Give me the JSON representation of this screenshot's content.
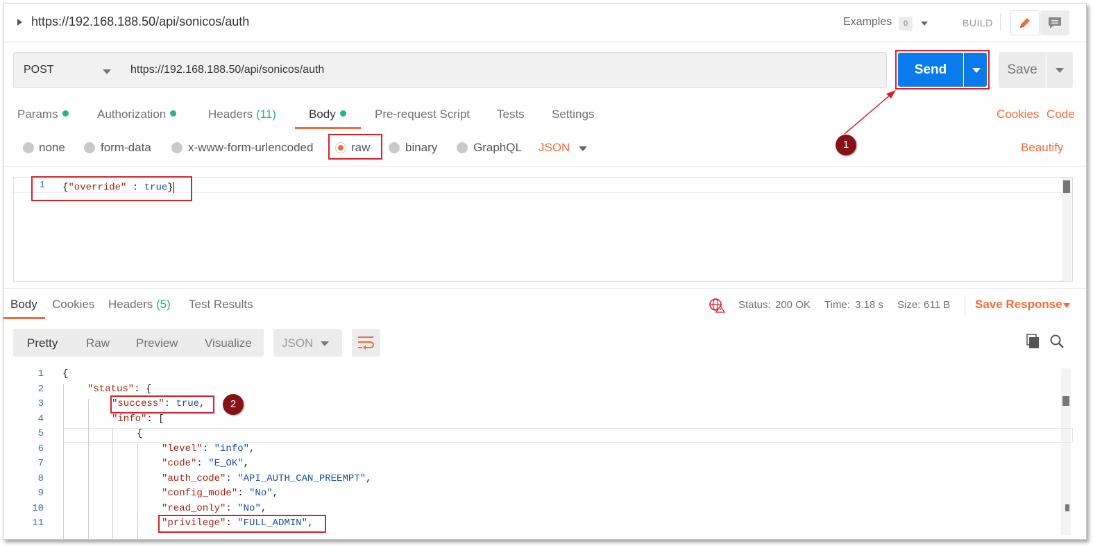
{
  "topbar": {
    "title": "https://192.168.188.50/api/sonicos/auth",
    "examples_label": "Examples",
    "examples_count": "0",
    "build_label": "BUILD"
  },
  "request": {
    "method": "POST",
    "url": "https://192.168.188.50/api/sonicos/auth",
    "send_label": "Send",
    "save_label": "Save"
  },
  "request_tabs": {
    "params": "Params",
    "authorization": "Authorization",
    "headers": "Headers",
    "headers_count": "(11)",
    "body": "Body",
    "prerequest": "Pre-request Script",
    "tests": "Tests",
    "settings": "Settings",
    "cookies": "Cookies",
    "code": "Code"
  },
  "body_types": {
    "none": "none",
    "form_data": "form-data",
    "urlencoded": "x-www-form-urlencoded",
    "raw": "raw",
    "binary": "binary",
    "graphql": "GraphQL",
    "json": "JSON",
    "beautify": "Beautify",
    "selected": "raw"
  },
  "request_body": {
    "line_number": "1",
    "open_brace": "{",
    "key": "\"override\"",
    "sep": " : ",
    "value": "true",
    "close_brace": "}"
  },
  "response_tabs": {
    "body": "Body",
    "cookies": "Cookies",
    "headers": "Headers",
    "headers_count": "(5)",
    "test_results": "Test Results"
  },
  "response_meta": {
    "status_label": "Status:",
    "status_value": "200 OK",
    "time_label": "Time:",
    "time_value": "3.18 s",
    "size_label": "Size:",
    "size_value": "611 B",
    "save_response": "Save Response"
  },
  "response_format": {
    "pretty": "Pretty",
    "raw": "Raw",
    "preview": "Preview",
    "visualize": "Visualize",
    "json": "JSON"
  },
  "response_body": {
    "line_numbers": [
      "1",
      "2",
      "3",
      "4",
      "5",
      "6",
      "7",
      "8",
      "9",
      "10",
      "11"
    ],
    "l1": "{",
    "l2_key": "\"status\"",
    "l2_rest": ": {",
    "l3_key": "\"success\"",
    "l3_colon": ": ",
    "l3_val": "true",
    "l3_end": ",",
    "l4_key": "\"info\"",
    "l4_rest": ": [",
    "l5": "{",
    "l6_key": "\"level\"",
    "l6_val": "\"info\"",
    "l7_key": "\"code\"",
    "l7_val": "\"E_OK\"",
    "l8_key": "\"auth_code\"",
    "l8_val": "\"API_AUTH_CAN_PREEMPT\"",
    "l9_key": "\"config_mode\"",
    "l9_val": "\"No\"",
    "l10_key": "\"read_only\"",
    "l10_val": "\"No\"",
    "l11_key": "\"privilege\"",
    "l11_val": "\"FULL_ADMIN\"",
    "colon": ": ",
    "comma": ","
  },
  "annotations": {
    "badge1": "1",
    "badge2": "2"
  },
  "colors": {
    "accent": "#f26b3a",
    "send_blue": "#097bed",
    "annotation_red": "#d9202a",
    "badge_red": "#861217",
    "status_green": "#26b47f"
  }
}
